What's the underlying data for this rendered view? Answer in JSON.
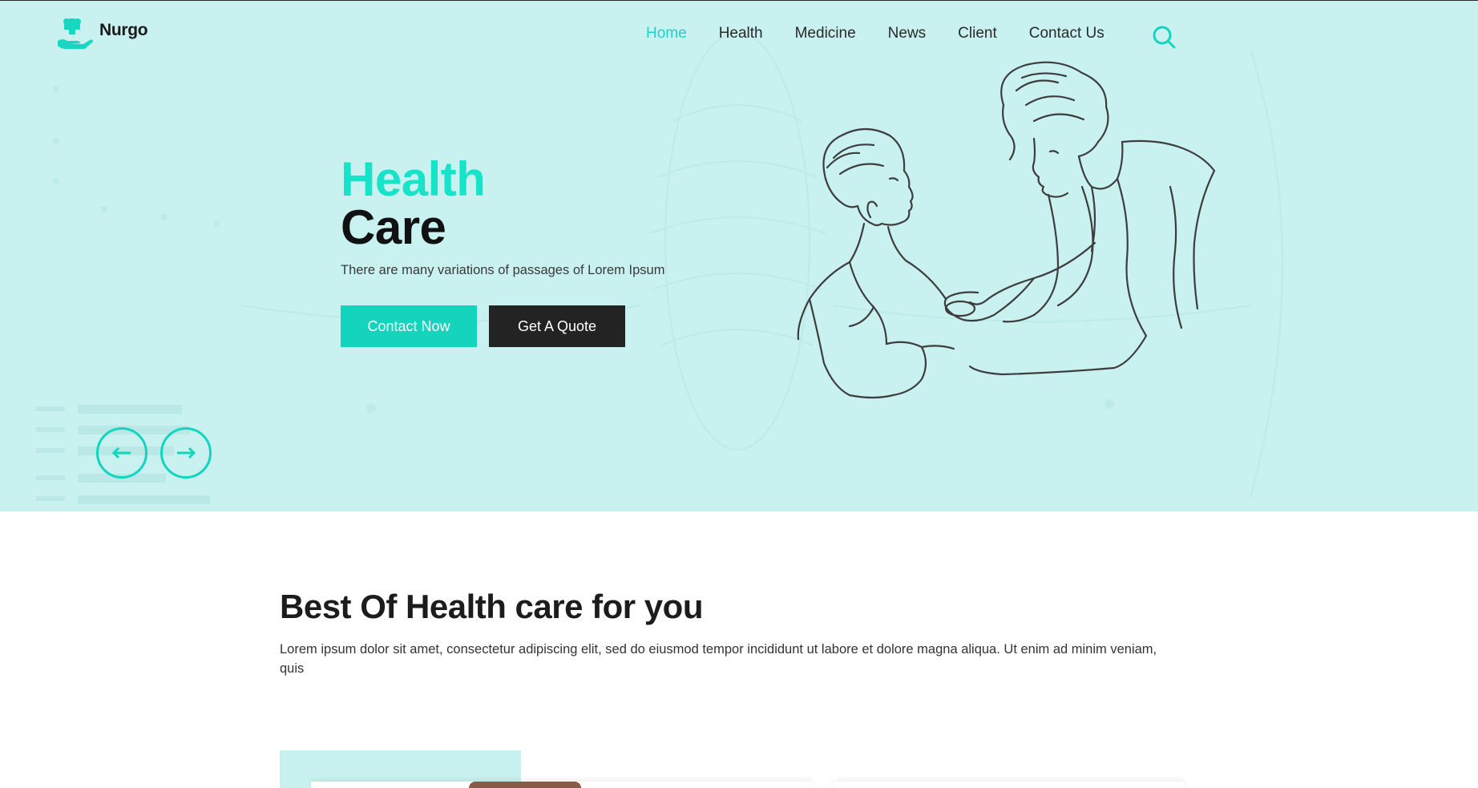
{
  "brand": {
    "name": "Nurgo",
    "accent": "#14d4be",
    "dark": "#232323",
    "hero_bg": "#c8f1f0"
  },
  "nav": {
    "items": [
      {
        "label": "Home",
        "active": true
      },
      {
        "label": "Health",
        "active": false
      },
      {
        "label": "Medicine",
        "active": false
      },
      {
        "label": "News",
        "active": false
      },
      {
        "label": "Client",
        "active": false
      },
      {
        "label": "Contact Us",
        "active": false
      }
    ],
    "search_icon": "search-icon"
  },
  "hero": {
    "title_line1": "Health",
    "title_line2": "Care",
    "subtitle": "There are many variations of passages of Lorem Ipsum",
    "contact_button": "Contact Now",
    "quote_button": "Get A Quote",
    "prev_icon": "arrow-left-icon",
    "next_icon": "arrow-right-icon"
  },
  "section": {
    "title": "Best Of Health care for you",
    "text": "Lorem ipsum dolor sit amet, consectetur adipiscing elit, sed do eiusmod tempor incididunt ut labore et dolore magna aliqua. Ut enim ad minim veniam, quis"
  }
}
